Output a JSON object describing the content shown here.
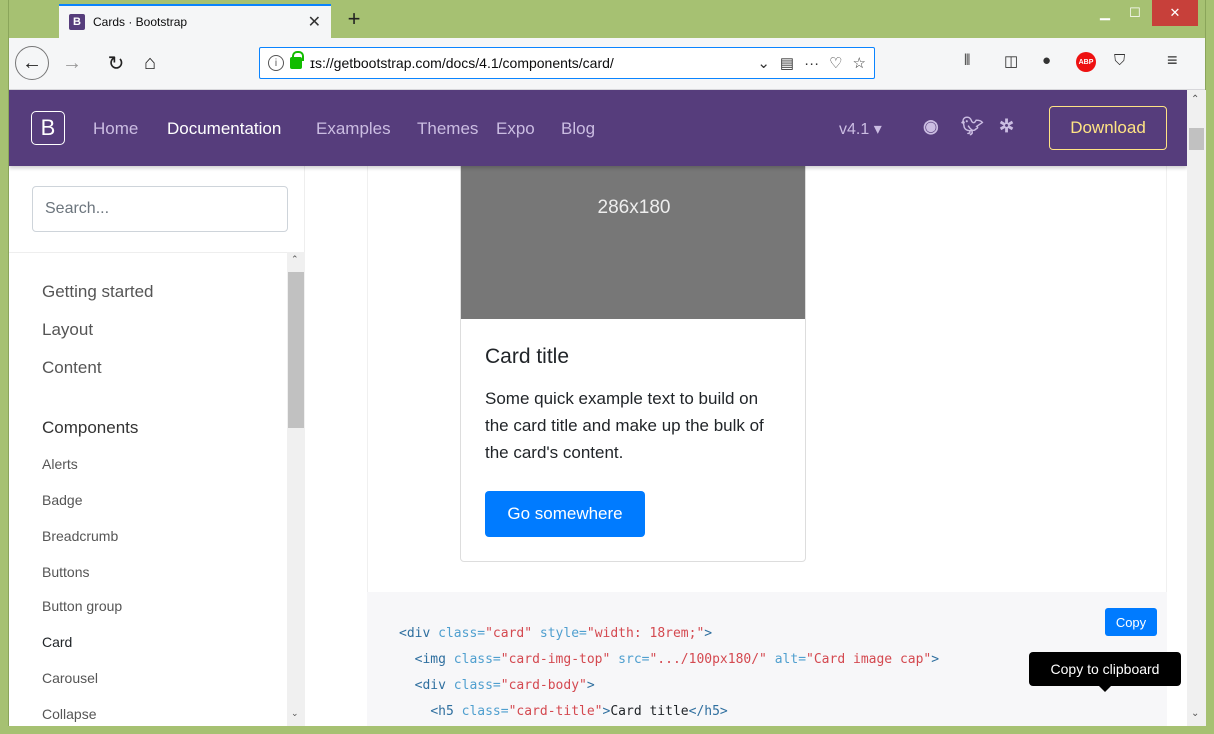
{
  "browser": {
    "tab_title": "Cards · Bootstrap",
    "tab_favicon": "B",
    "url": "ɪs://getbootstrap.com/docs/4.1/components/card/",
    "window_controls": [
      "minimize",
      "maximize",
      "close"
    ]
  },
  "navbar": {
    "brand": "B",
    "links": [
      "Home",
      "Documentation",
      "Examples",
      "Themes",
      "Expo",
      "Blog"
    ],
    "active_link": "Documentation",
    "version": "v4.1 ▾",
    "download_label": "Download",
    "icons": [
      "github-icon",
      "twitter-icon",
      "slack-icon"
    ],
    "colors": {
      "navbar_bg": "#563d7c",
      "download_border": "#ffe484"
    }
  },
  "sidebar": {
    "search_placeholder": "Search...",
    "groups": [
      "Getting started",
      "Layout",
      "Content",
      "Components"
    ],
    "items": [
      "Alerts",
      "Badge",
      "Breadcrumb",
      "Buttons",
      "Button group",
      "Card",
      "Carousel",
      "Collapse"
    ],
    "active_item": "Card"
  },
  "card": {
    "image_label": "286x180",
    "title": "Card title",
    "text": "Some quick example text to build on the card title and make up the bulk of the card's content.",
    "button_label": "Go somewhere",
    "colors": {
      "button_bg": "#007bff",
      "image_bg": "#777777"
    }
  },
  "code": {
    "copy_label": "Copy",
    "tooltip": "Copy to clipboard",
    "lines": [
      "<div class=\"card\" style=\"width: 18rem;\">",
      "  <img class=\"card-img-top\" src=\".../100px180/\" alt=\"Card image cap\">",
      "  <div class=\"card-body\">",
      "    <h5 class=\"card-title\">Card title</h5>"
    ]
  }
}
